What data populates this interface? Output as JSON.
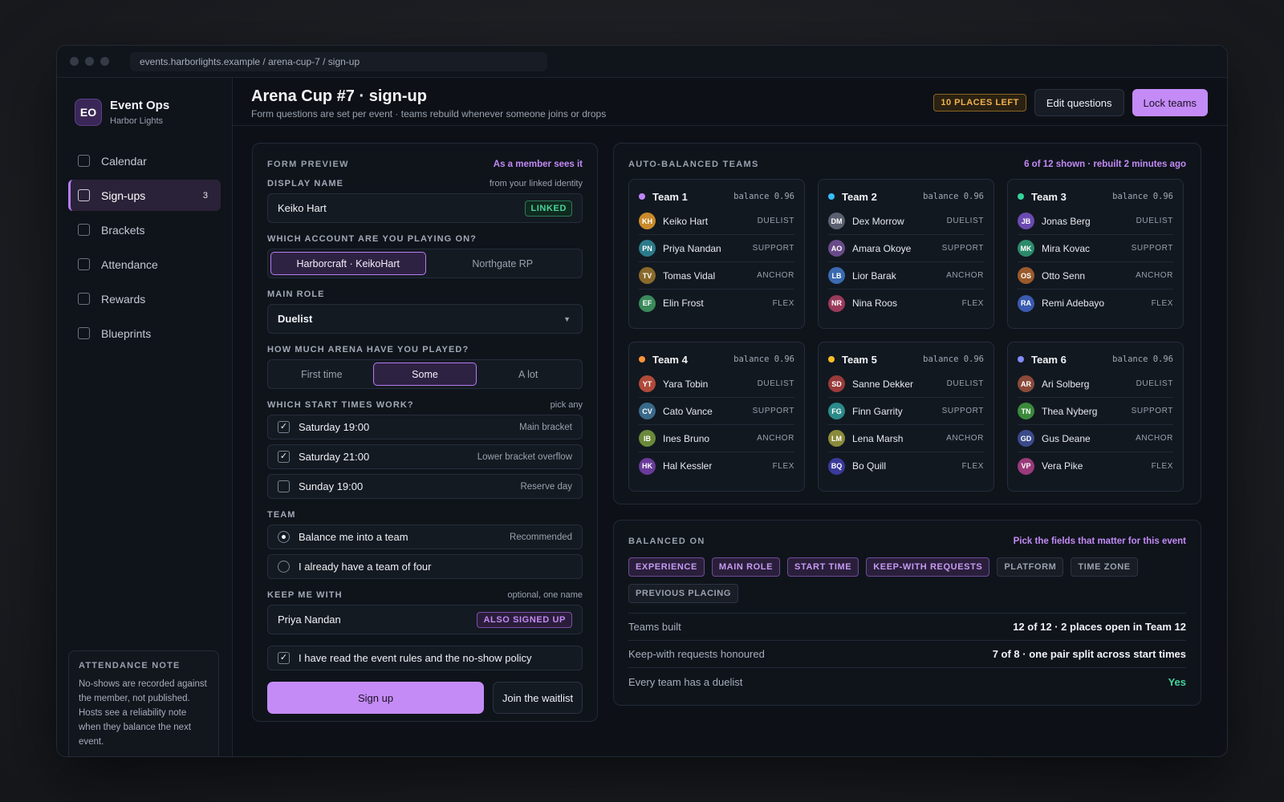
{
  "url": "events.harborlights.example / arena-cup-7 / sign-up",
  "brand": {
    "logo": "EO",
    "name": "Event Ops",
    "sub": "Harbor Lights"
  },
  "nav": [
    {
      "label": "Calendar"
    },
    {
      "label": "Sign-ups",
      "count": "3",
      "active": true
    },
    {
      "label": "Brackets"
    },
    {
      "label": "Attendance"
    },
    {
      "label": "Rewards"
    },
    {
      "label": "Blueprints"
    }
  ],
  "attendance_note": {
    "title": "ATTENDANCE NOTE",
    "body": "No-shows are recorded against the member, not published. Hosts see a reliability note when they balance the next event."
  },
  "header": {
    "title": "Arena Cup #7 · sign-up",
    "subtitle": "Form questions are set per event · teams rebuild whenever someone joins or drops",
    "places_badge": "10 PLACES LEFT",
    "edit_label": "Edit questions",
    "lock_label": "Lock teams"
  },
  "form": {
    "title": "FORM PREVIEW",
    "accent": "As a member sees it",
    "display_name": {
      "label": "DISPLAY NAME",
      "hint": "from your linked identity",
      "value": "Keiko Hart",
      "tag": "LINKED"
    },
    "account": {
      "label": "WHICH ACCOUNT ARE YOU PLAYING ON?",
      "options": [
        "Harborcraft · KeikoHart",
        "Northgate RP"
      ]
    },
    "main_role": {
      "label": "MAIN ROLE",
      "value": "Duelist"
    },
    "experience": {
      "label": "HOW MUCH ARENA HAVE YOU PLAYED?",
      "options": [
        "First time",
        "Some",
        "A lot"
      ]
    },
    "start_times": {
      "label": "WHICH START TIMES WORK?",
      "hint": "pick any",
      "items": [
        {
          "label": "Saturday 19:00",
          "note": "Main bracket",
          "checked": true
        },
        {
          "label": "Saturday 21:00",
          "note": "Lower bracket overflow",
          "checked": true
        },
        {
          "label": "Sunday 19:00",
          "note": "Reserve day",
          "checked": false
        }
      ]
    },
    "team": {
      "label": "TEAM",
      "items": [
        {
          "label": "Balance me into a team",
          "note": "Recommended",
          "selected": true
        },
        {
          "label": "I already have a team of four",
          "note": "",
          "selected": false
        }
      ]
    },
    "keep_with": {
      "label": "KEEP ME WITH",
      "hint": "optional, one name",
      "value": "Priya Nandan",
      "tag": "ALSO SIGNED UP"
    },
    "rules": {
      "label": "I have read the event rules and the no-show policy",
      "checked": true
    },
    "signup_label": "Sign up",
    "waitlist_label": "Join the waitlist"
  },
  "teams": {
    "title": "AUTO-BALANCED TEAMS",
    "accent": "6 of 12 shown · rebuilt 2 minutes ago",
    "list": [
      {
        "name": "Team 1",
        "color": "#c084fc",
        "balance": "balance 0.96",
        "members": [
          {
            "initials": "KH",
            "name": "Keiko Hart",
            "role": "DUELIST",
            "color": "#c98a2b"
          },
          {
            "initials": "PN",
            "name": "Priya Nandan",
            "role": "SUPPORT",
            "color": "#2b7a8a"
          },
          {
            "initials": "TV",
            "name": "Tomas Vidal",
            "role": "ANCHOR",
            "color": "#8a6a2b"
          },
          {
            "initials": "EF",
            "name": "Elin Frost",
            "role": "FLEX",
            "color": "#3a8a5a"
          }
        ]
      },
      {
        "name": "Team 2",
        "color": "#38bdf8",
        "balance": "balance 0.96",
        "members": [
          {
            "initials": "DM",
            "name": "Dex Morrow",
            "role": "DUELIST",
            "color": "#5a6070"
          },
          {
            "initials": "AO",
            "name": "Amara Okoye",
            "role": "SUPPORT",
            "color": "#6a4a8a"
          },
          {
            "initials": "LB",
            "name": "Lior Barak",
            "role": "ANCHOR",
            "color": "#3a6ab0"
          },
          {
            "initials": "NR",
            "name": "Nina Roos",
            "role": "FLEX",
            "color": "#9a3a5a"
          }
        ]
      },
      {
        "name": "Team 3",
        "color": "#34d399",
        "balance": "balance 0.96",
        "members": [
          {
            "initials": "JB",
            "name": "Jonas Berg",
            "role": "DUELIST",
            "color": "#6a4ab0"
          },
          {
            "initials": "MK",
            "name": "Mira Kovac",
            "role": "SUPPORT",
            "color": "#2b8a6a"
          },
          {
            "initials": "OS",
            "name": "Otto Senn",
            "role": "ANCHOR",
            "color": "#9a5a2b"
          },
          {
            "initials": "RA",
            "name": "Remi Adebayo",
            "role": "FLEX",
            "color": "#3a5ab0"
          }
        ]
      },
      {
        "name": "Team 4",
        "color": "#fb923c",
        "balance": "balance 0.96",
        "members": [
          {
            "initials": "YT",
            "name": "Yara Tobin",
            "role": "DUELIST",
            "color": "#b04a3a"
          },
          {
            "initials": "CV",
            "name": "Cato Vance",
            "role": "SUPPORT",
            "color": "#3a6a8a"
          },
          {
            "initials": "IB",
            "name": "Ines Bruno",
            "role": "ANCHOR",
            "color": "#6a8a3a"
          },
          {
            "initials": "HK",
            "name": "Hal Kessler",
            "role": "FLEX",
            "color": "#6a3a9a"
          }
        ]
      },
      {
        "name": "Team 5",
        "color": "#fbbf24",
        "balance": "balance 0.96",
        "members": [
          {
            "initials": "SD",
            "name": "Sanne Dekker",
            "role": "DUELIST",
            "color": "#9a3a3a"
          },
          {
            "initials": "FG",
            "name": "Finn Garrity",
            "role": "SUPPORT",
            "color": "#2b8a8a"
          },
          {
            "initials": "LM",
            "name": "Lena Marsh",
            "role": "ANCHOR",
            "color": "#8a8a3a"
          },
          {
            "initials": "BQ",
            "name": "Bo Quill",
            "role": "FLEX",
            "color": "#3a3a9a"
          }
        ]
      },
      {
        "name": "Team 6",
        "color": "#818cf8",
        "balance": "balance 0.96",
        "members": [
          {
            "initials": "AR",
            "name": "Ari Solberg",
            "role": "DUELIST",
            "color": "#8a4a3a"
          },
          {
            "initials": "TN",
            "name": "Thea Nyberg",
            "role": "SUPPORT",
            "color": "#3a8a3a"
          },
          {
            "initials": "GD",
            "name": "Gus Deane",
            "role": "ANCHOR",
            "color": "#3a4a8a"
          },
          {
            "initials": "VP",
            "name": "Vera Pike",
            "role": "FLEX",
            "color": "#9a3a7a"
          }
        ]
      }
    ]
  },
  "balanced": {
    "title": "BALANCED ON",
    "accent": "Pick the fields that matter for this event",
    "chips": [
      {
        "label": "EXPERIENCE",
        "on": true
      },
      {
        "label": "MAIN ROLE",
        "on": true
      },
      {
        "label": "START TIME",
        "on": true
      },
      {
        "label": "KEEP-WITH REQUESTS",
        "on": true
      },
      {
        "label": "PLATFORM",
        "on": false
      },
      {
        "label": "TIME ZONE",
        "on": false
      },
      {
        "label": "PREVIOUS PLACING",
        "on": false
      }
    ],
    "stats": [
      {
        "label": "Teams built",
        "value": "12 of 12 · 2 places open in Team 12"
      },
      {
        "label": "Keep-with requests honoured",
        "value": "7 of 8 · one pair split across start times"
      },
      {
        "label": "Every team has a duelist",
        "value": "Yes",
        "positive": true
      }
    ]
  }
}
